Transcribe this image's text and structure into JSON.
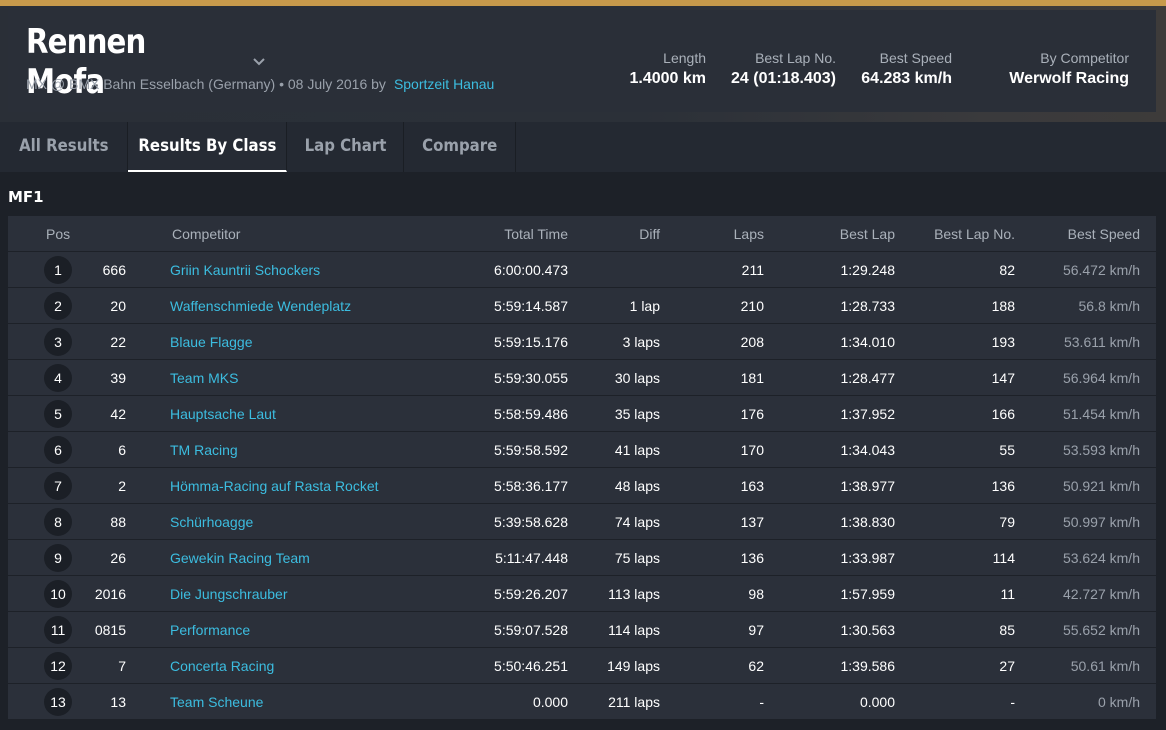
{
  "event": {
    "title": "Rennen Mofa",
    "subtitle": "MX @ BMX Bahn Esselbach (Germany) • 08 July 2016 by",
    "organizer": "Sportzeit Hanau"
  },
  "stats": [
    {
      "label": "Length",
      "value": "1.4000 km"
    },
    {
      "label": "Best Lap No.",
      "value": "24 (01:18.403)"
    },
    {
      "label": "Best Speed",
      "value": "64.283 km/h"
    },
    {
      "label": "By Competitor",
      "value": "Werwolf Racing"
    }
  ],
  "tabs": [
    {
      "label": "All Results"
    },
    {
      "label": "Results By Class"
    },
    {
      "label": "Lap Chart"
    },
    {
      "label": "Compare"
    }
  ],
  "active_tab": "Results By Class",
  "class_name": "MF1",
  "columns": {
    "pos": "Pos",
    "competitor": "Competitor",
    "total_time": "Total Time",
    "diff": "Diff",
    "laps": "Laps",
    "best_lap": "Best Lap",
    "best_lap_no": "Best Lap No.",
    "best_speed": "Best Speed"
  },
  "rows": [
    {
      "pos": "1",
      "no": "666",
      "competitor": "Griin Kauntrii Schockers",
      "total": "6:00:00.473",
      "diff": "",
      "laps": "211",
      "best_lap": "1:29.248",
      "best_lap_no": "82",
      "speed": "56.472 km/h"
    },
    {
      "pos": "2",
      "no": "20",
      "competitor": "Waffenschmiede Wendeplatz",
      "total": "5:59:14.587",
      "diff": "1 lap",
      "laps": "210",
      "best_lap": "1:28.733",
      "best_lap_no": "188",
      "speed": "56.8 km/h"
    },
    {
      "pos": "3",
      "no": "22",
      "competitor": "Blaue Flagge",
      "total": "5:59:15.176",
      "diff": "3 laps",
      "laps": "208",
      "best_lap": "1:34.010",
      "best_lap_no": "193",
      "speed": "53.611 km/h"
    },
    {
      "pos": "4",
      "no": "39",
      "competitor": "Team MKS",
      "total": "5:59:30.055",
      "diff": "30 laps",
      "laps": "181",
      "best_lap": "1:28.477",
      "best_lap_no": "147",
      "speed": "56.964 km/h"
    },
    {
      "pos": "5",
      "no": "42",
      "competitor": "Hauptsache Laut",
      "total": "5:58:59.486",
      "diff": "35 laps",
      "laps": "176",
      "best_lap": "1:37.952",
      "best_lap_no": "166",
      "speed": "51.454 km/h"
    },
    {
      "pos": "6",
      "no": "6",
      "competitor": "TM Racing",
      "total": "5:59:58.592",
      "diff": "41 laps",
      "laps": "170",
      "best_lap": "1:34.043",
      "best_lap_no": "55",
      "speed": "53.593 km/h"
    },
    {
      "pos": "7",
      "no": "2",
      "competitor": "Hömma-Racing auf Rasta Rocket",
      "total": "5:58:36.177",
      "diff": "48 laps",
      "laps": "163",
      "best_lap": "1:38.977",
      "best_lap_no": "136",
      "speed": "50.921 km/h"
    },
    {
      "pos": "8",
      "no": "88",
      "competitor": "Schürhoagge",
      "total": "5:39:58.628",
      "diff": "74 laps",
      "laps": "137",
      "best_lap": "1:38.830",
      "best_lap_no": "79",
      "speed": "50.997 km/h"
    },
    {
      "pos": "9",
      "no": "26",
      "competitor": "Gewekin Racing Team",
      "total": "5:11:47.448",
      "diff": "75 laps",
      "laps": "136",
      "best_lap": "1:33.987",
      "best_lap_no": "114",
      "speed": "53.624 km/h"
    },
    {
      "pos": "10",
      "no": "2016",
      "competitor": "Die Jungschrauber",
      "total": "5:59:26.207",
      "diff": "113 laps",
      "laps": "98",
      "best_lap": "1:57.959",
      "best_lap_no": "11",
      "speed": "42.727 km/h"
    },
    {
      "pos": "11",
      "no": "0815",
      "competitor": "Performance",
      "total": "5:59:07.528",
      "diff": "114 laps",
      "laps": "97",
      "best_lap": "1:30.563",
      "best_lap_no": "85",
      "speed": "55.652 km/h"
    },
    {
      "pos": "12",
      "no": "7",
      "competitor": "Concerta Racing",
      "total": "5:50:46.251",
      "diff": "149 laps",
      "laps": "62",
      "best_lap": "1:39.586",
      "best_lap_no": "27",
      "speed": "50.61 km/h"
    },
    {
      "pos": "13",
      "no": "13",
      "competitor": "Team Scheune",
      "total": "0.000",
      "diff": "211 laps",
      "laps": "-",
      "best_lap": "0.000",
      "best_lap_no": "-",
      "speed": "0 km/h"
    }
  ]
}
